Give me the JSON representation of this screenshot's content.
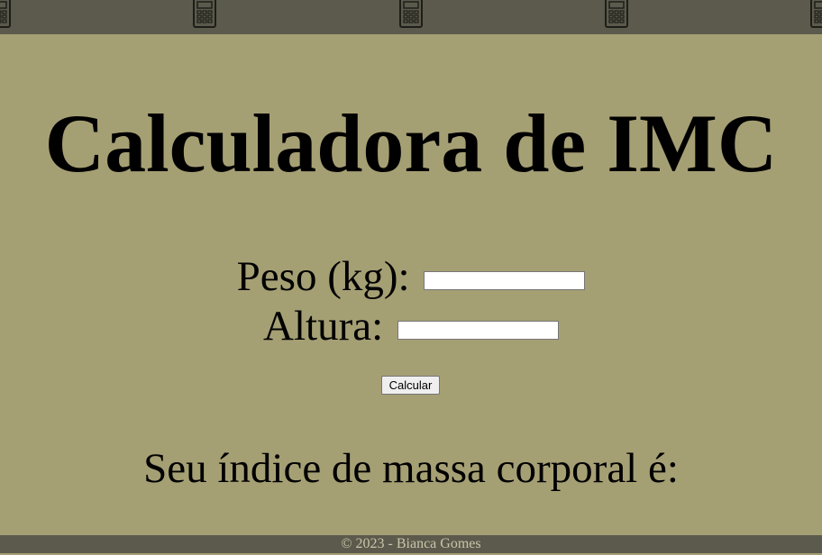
{
  "header": {
    "pattern_icon": "calculator-icon",
    "bar_color": "#5b5a4c"
  },
  "main": {
    "title": "Calculadora de IMC",
    "weight_label": "Peso (kg):",
    "weight_value": "",
    "height_label": "Altura:",
    "height_value": "",
    "calculate_button": "Calcular",
    "result_text": "Seu índice de massa corporal é:"
  },
  "footer": {
    "copyright": "© 2023 - Bianca Gomes"
  },
  "colors": {
    "background": "#a59f74",
    "bars": "#5b5a4c",
    "footer_text": "#c9c5a9"
  }
}
